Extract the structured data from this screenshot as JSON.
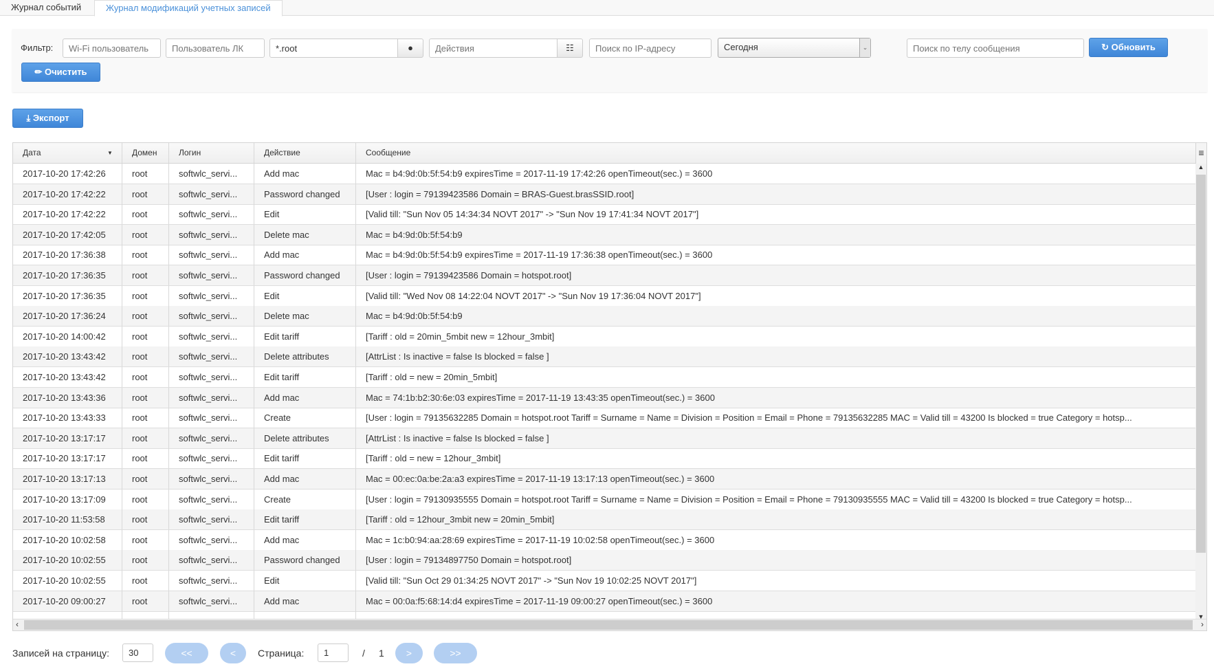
{
  "tabs": [
    {
      "label": "Журнал событий",
      "active": false
    },
    {
      "label": "Журнал модификаций учетных записей",
      "active": true
    }
  ],
  "filter": {
    "label": "Фильтр:",
    "wifi_user_placeholder": "Wi-Fi пользователь",
    "lk_user_placeholder": "Пользователь ЛК",
    "domain_value": "*.root",
    "actions_placeholder": "Действия",
    "ip_placeholder": "Поиск по IP-адресу",
    "period_value": "Сегодня",
    "message_placeholder": "Поиск по телу сообщения",
    "refresh_label": "Обновить",
    "clear_label": "Очистить"
  },
  "export_label": "Экспорт",
  "accent_color": "#4a90d9",
  "table": {
    "columns": [
      "Дата",
      "Домен",
      "Логин",
      "Действие",
      "Сообщение"
    ],
    "sort_column": "Дата",
    "rows": [
      [
        "2017-10-20 17:42:26",
        "root",
        "softwlc_servi...",
        "Add mac",
        "Mac = b4:9d:0b:5f:54:b9 expiresTime = 2017-11-19 17:42:26 openTimeout(sec.) = 3600"
      ],
      [
        "2017-10-20 17:42:22",
        "root",
        "softwlc_servi...",
        "Password changed",
        "[User : login = 79139423586 Domain = BRAS-Guest.brasSSID.root]"
      ],
      [
        "2017-10-20 17:42:22",
        "root",
        "softwlc_servi...",
        "Edit",
        "[Valid till: \"Sun Nov 05 14:34:34 NOVT 2017\" -> \"Sun Nov 19 17:41:34 NOVT 2017\"]"
      ],
      [
        "2017-10-20 17:42:05",
        "root",
        "softwlc_servi...",
        "Delete mac",
        "Mac = b4:9d:0b:5f:54:b9"
      ],
      [
        "2017-10-20 17:36:38",
        "root",
        "softwlc_servi...",
        "Add mac",
        "Mac = b4:9d:0b:5f:54:b9 expiresTime = 2017-11-19 17:36:38 openTimeout(sec.) = 3600"
      ],
      [
        "2017-10-20 17:36:35",
        "root",
        "softwlc_servi...",
        "Password changed",
        "[User : login = 79139423586 Domain = hotspot.root]"
      ],
      [
        "2017-10-20 17:36:35",
        "root",
        "softwlc_servi...",
        "Edit",
        "[Valid till: \"Wed Nov 08 14:22:04 NOVT 2017\" -> \"Sun Nov 19 17:36:04 NOVT 2017\"]"
      ],
      [
        "2017-10-20 17:36:24",
        "root",
        "softwlc_servi...",
        "Delete mac",
        "Mac = b4:9d:0b:5f:54:b9"
      ],
      [
        "2017-10-20 14:00:42",
        "root",
        "softwlc_servi...",
        "Edit tariff",
        "[Tariff : old = 20min_5mbit new = 12hour_3mbit]"
      ],
      [
        "2017-10-20 13:43:42",
        "root",
        "softwlc_servi...",
        "Delete attributes",
        "[AttrList : Is inactive = false Is blocked = false ]"
      ],
      [
        "2017-10-20 13:43:42",
        "root",
        "softwlc_servi...",
        "Edit tariff",
        "[Tariff : old = new = 20min_5mbit]"
      ],
      [
        "2017-10-20 13:43:36",
        "root",
        "softwlc_servi...",
        "Add mac",
        "Mac = 74:1b:b2:30:6e:03 expiresTime = 2017-11-19 13:43:35 openTimeout(sec.) = 3600"
      ],
      [
        "2017-10-20 13:43:33",
        "root",
        "softwlc_servi...",
        "Create",
        "[User : login = 79135632285 Domain = hotspot.root Tariff = Surname = Name = Division = Position = Email = Phone = 79135632285 MAC = Valid till = 43200 Is blocked = true Category = hotsp..."
      ],
      [
        "2017-10-20 13:17:17",
        "root",
        "softwlc_servi...",
        "Delete attributes",
        "[AttrList : Is inactive = false Is blocked = false ]"
      ],
      [
        "2017-10-20 13:17:17",
        "root",
        "softwlc_servi...",
        "Edit tariff",
        "[Tariff : old = new = 12hour_3mbit]"
      ],
      [
        "2017-10-20 13:17:13",
        "root",
        "softwlc_servi...",
        "Add mac",
        "Mac = 00:ec:0a:be:2a:a3 expiresTime = 2017-11-19 13:17:13 openTimeout(sec.) = 3600"
      ],
      [
        "2017-10-20 13:17:09",
        "root",
        "softwlc_servi...",
        "Create",
        "[User : login = 79130935555 Domain = hotspot.root Tariff = Surname = Name = Division = Position = Email = Phone = 79130935555 MAC = Valid till = 43200 Is blocked = true Category = hotsp..."
      ],
      [
        "2017-10-20 11:53:58",
        "root",
        "softwlc_servi...",
        "Edit tariff",
        "[Tariff : old = 12hour_3mbit new = 20min_5mbit]"
      ],
      [
        "2017-10-20 10:02:58",
        "root",
        "softwlc_servi...",
        "Add mac",
        "Mac = 1c:b0:94:aa:28:69 expiresTime = 2017-11-19 10:02:58 openTimeout(sec.) = 3600"
      ],
      [
        "2017-10-20 10:02:55",
        "root",
        "softwlc_servi...",
        "Password changed",
        "[User : login = 79134897750 Domain = hotspot.root]"
      ],
      [
        "2017-10-20 10:02:55",
        "root",
        "softwlc_servi...",
        "Edit",
        "[Valid till: \"Sun Oct 29 01:34:25 NOVT 2017\" -> \"Sun Nov 19 10:02:25 NOVT 2017\"]"
      ],
      [
        "2017-10-20 09:00:27",
        "root",
        "softwlc_servi...",
        "Add mac",
        "Mac = 00:0a:f5:68:14:d4 expiresTime = 2017-11-19 09:00:27 openTimeout(sec.) = 3600"
      ]
    ]
  },
  "pager": {
    "per_page_label": "Записей на страницу:",
    "per_page_value": "30",
    "first_label": "<<",
    "prev_label": "<",
    "page_label": "Страница:",
    "page_value": "1",
    "separator": "/",
    "total_pages": "1",
    "next_label": ">",
    "last_label": ">>"
  }
}
